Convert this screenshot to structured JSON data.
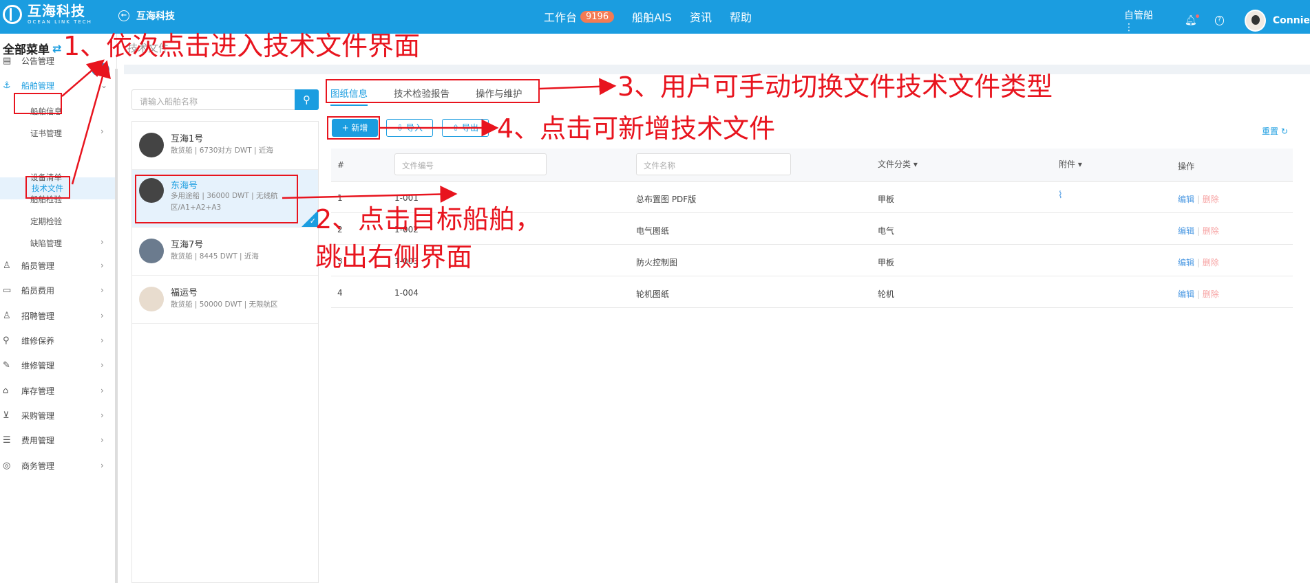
{
  "header": {
    "logo_cn": "互海科技",
    "logo_en": "OCEAN LINK TECH",
    "back_label": "互海科技",
    "nav": [
      {
        "label": "工作台",
        "badge": "9196"
      },
      {
        "label": "船舶AIS"
      },
      {
        "label": "资讯"
      },
      {
        "label": "帮助"
      }
    ],
    "role": "自管船",
    "user": "Connie"
  },
  "sidebar": {
    "title": "全部菜单",
    "items": [
      {
        "label": "公告管理"
      },
      {
        "label": "船舶管理"
      },
      {
        "label": "船员管理"
      },
      {
        "label": "船员费用"
      },
      {
        "label": "招聘管理"
      },
      {
        "label": "维修保养"
      },
      {
        "label": "维修管理"
      },
      {
        "label": "库存管理"
      },
      {
        "label": "采购管理"
      },
      {
        "label": "费用管理"
      },
      {
        "label": "商务管理"
      }
    ],
    "ship_submenu": [
      "船舶信息",
      "证书管理",
      "技术文件",
      "设备清单",
      "船舶检验",
      "定期检验",
      "缺陷管理"
    ]
  },
  "breadcrumb": "技术文件",
  "ship_search": {
    "placeholder": "请输入船舶名称"
  },
  "ships": [
    {
      "name": "互海1号",
      "desc": "散货船 | 6730对方 DWT | 近海"
    },
    {
      "name": "东海号",
      "desc": "多用途船 | 36000 DWT | 无线航区/A1+A2+A3"
    },
    {
      "name": "互海7号",
      "desc": "散货船 | 8445 DWT | 近海"
    },
    {
      "name": "福运号",
      "desc": "散货船 | 50000 DWT | 无限航区"
    }
  ],
  "tabs": [
    "图纸信息",
    "技术检验报告",
    "操作与维护"
  ],
  "toolbar": {
    "add": "+ 新增",
    "import": "导入",
    "export": "导出",
    "reset": "重置"
  },
  "table": {
    "headers": {
      "index": "#",
      "category": "文件分类",
      "attachment": "附件",
      "action": "操作"
    },
    "filters": {
      "code": "文件编号",
      "name": "文件名称"
    },
    "rows": [
      {
        "index": "1",
        "code": "1-001",
        "name": "总布置图 PDF版",
        "category": "甲板",
        "attach": true
      },
      {
        "index": "2",
        "code": "1-002",
        "name": "电气图纸",
        "category": "电气",
        "attach": false
      },
      {
        "index": "3",
        "code": "1-003",
        "name": "防火控制图",
        "category": "甲板",
        "attach": false
      },
      {
        "index": "4",
        "code": "1-004",
        "name": "轮机图纸",
        "category": "轮机",
        "attach": false
      }
    ],
    "edit": "编辑",
    "delete": "删除"
  },
  "annotations": {
    "a1": "1、依次点击进入技术文件界面",
    "a2_line1": "2、点击目标船舶，",
    "a2_line2": "跳出右侧界面",
    "a3": "3、用户可手动切换文件技术文件类型",
    "a4": "4、点击可新增技术文件"
  },
  "colors": {
    "accent": "#1b9de0",
    "annotation": "#e8141e",
    "badge": "#f37b54"
  }
}
